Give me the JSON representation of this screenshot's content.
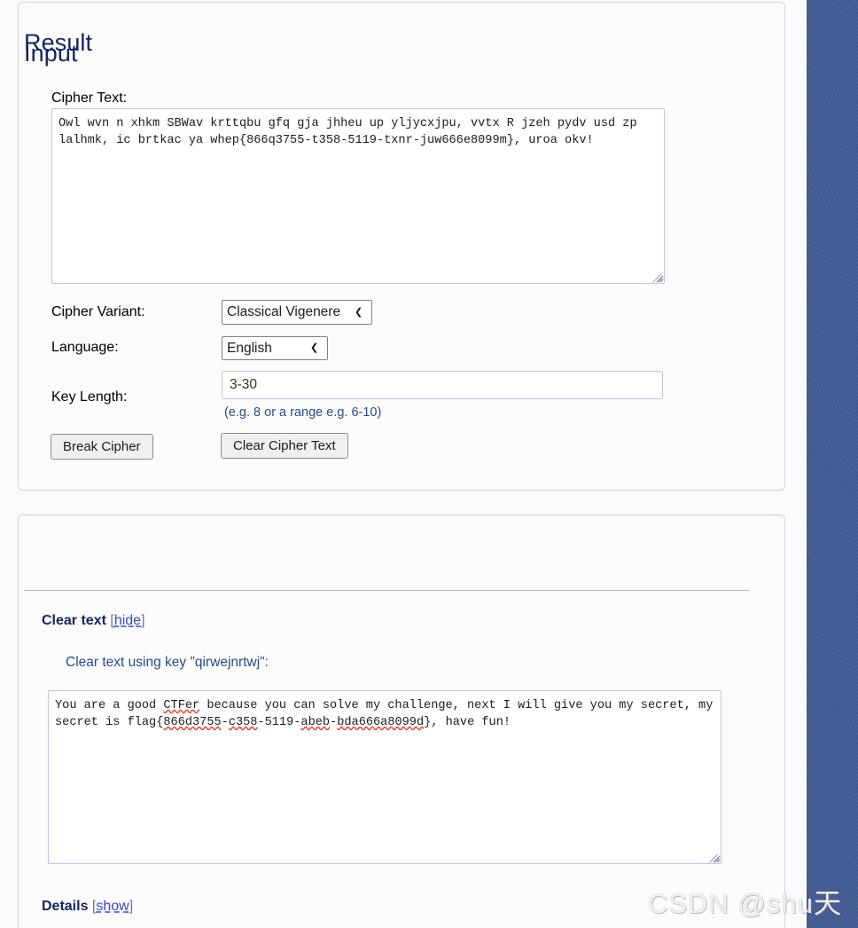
{
  "input": {
    "title": "Input",
    "cipher_text_label": "Cipher Text:",
    "cipher_text_value": "Owl wvn n xhkm SBWav krttqbu gfq gja jhheu up yljycxjpu, vvtx R jzeh pydv usd zp lalhmk, ic brtkac ya whep{866q3755-t358-5119-txnr-juw666e8099m}, uroa okv!",
    "cipher_variant_label": "Cipher Variant:",
    "cipher_variant_value": "Classical Vigenere",
    "cipher_variant_options": [
      "Classical Vigenere"
    ],
    "language_label": "Language:",
    "language_value": "English",
    "language_options": [
      "English"
    ],
    "key_length_label": "Key Length:",
    "key_length_value": "3-30",
    "key_length_hint": "(e.g. 8 or a range e.g. 6-10)",
    "break_button_label": "Break Cipher",
    "clear_button_label": "Clear Cipher Text",
    "dropdown_icon": "chevron-down-icon"
  },
  "result": {
    "title": "Result",
    "clear_text_heading": "Clear text",
    "clear_text_toggle": "hide",
    "clear_text_key_line": "Clear text using key \"qirwejnrtwj\":",
    "clear_text_key": "qirwejnrtwj",
    "clear_text_value": "You are a good CTFer because you can solve my challenge, next I will give you my secret, my secret is flag{866d3755-c358-5119-abeb-bda666a8099d}, have fun!",
    "clear_text_segments": [
      {
        "text": "You are a good ",
        "misspelled": false
      },
      {
        "text": "CTFer",
        "misspelled": true
      },
      {
        "text": " because you can solve my challenge, next I will give you my secret, my secret is flag{",
        "misspelled": false
      },
      {
        "text": "866d3755",
        "misspelled": true
      },
      {
        "text": "-",
        "misspelled": false
      },
      {
        "text": "c358",
        "misspelled": true
      },
      {
        "text": "-5119-",
        "misspelled": false
      },
      {
        "text": "abeb",
        "misspelled": true
      },
      {
        "text": "-",
        "misspelled": false
      },
      {
        "text": "bda666a8099d",
        "misspelled": true
      },
      {
        "text": "}, have fun!",
        "misspelled": false
      }
    ],
    "details_heading": "Details",
    "details_toggle": "show",
    "bracket_open": "[",
    "bracket_close": "]"
  },
  "watermark": {
    "text": "CSDN @shu天"
  },
  "colors": {
    "heading": "#17235c",
    "label": "#2b4a86",
    "link": "#3a47c9",
    "card_border": "#c9d3ea",
    "panel_blue": "#445b95",
    "spellcheck": "#e03b2f"
  }
}
